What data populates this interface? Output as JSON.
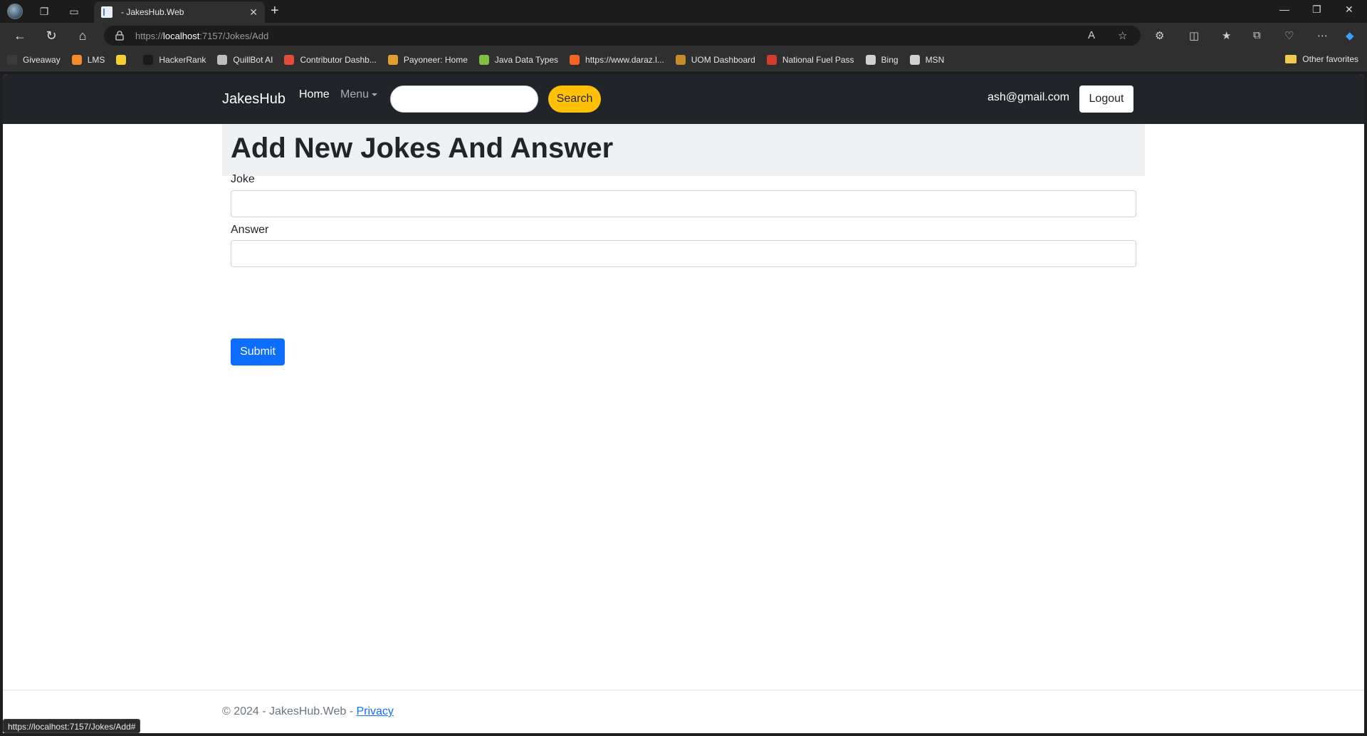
{
  "browser": {
    "tab_title": "- JakesHub.Web",
    "url_prefix": "https://",
    "url_host": "localhost",
    "url_path": ":7157/Jokes/Add",
    "status_url": "https://localhost:7157/Jokes/Add#",
    "bookmarks": [
      {
        "label": "Giveaway",
        "color": "#3b3b3b"
      },
      {
        "label": "LMS",
        "color": "#f28c28"
      },
      {
        "label": "",
        "color": "#f2d12e"
      },
      {
        "label": "HackerRank",
        "color": "#1a1a1a"
      },
      {
        "label": "QuillBot AI",
        "color": "#bdbdbd"
      },
      {
        "label": "Contributor Dashb...",
        "color": "#e64c3c"
      },
      {
        "label": "Payoneer: Home",
        "color": "#e0a030"
      },
      {
        "label": "Java Data Types",
        "color": "#7cc043"
      },
      {
        "label": "https://www.daraz.l...",
        "color": "#f26522"
      },
      {
        "label": "UOM Dashboard",
        "color": "#c58b2a"
      },
      {
        "label": "National Fuel Pass",
        "color": "#d63b2f"
      },
      {
        "label": "Bing",
        "color": "#cfcfcf"
      },
      {
        "label": "MSN",
        "color": "#cfcfcf"
      }
    ],
    "other_favorites": "Other favorites"
  },
  "navbar": {
    "brand": "JakesHub",
    "home": "Home",
    "menu": "Menu",
    "search_button": "Search",
    "user_email": "ash@gmail.com",
    "logout": "Logout"
  },
  "page": {
    "title": "Add New Jokes And Answer",
    "joke_label": "Joke",
    "answer_label": "Answer",
    "joke_value": "",
    "answer_value": "",
    "submit": "Submit"
  },
  "footer": {
    "text": "© 2024 - JakesHub.Web - ",
    "privacy": "Privacy"
  }
}
